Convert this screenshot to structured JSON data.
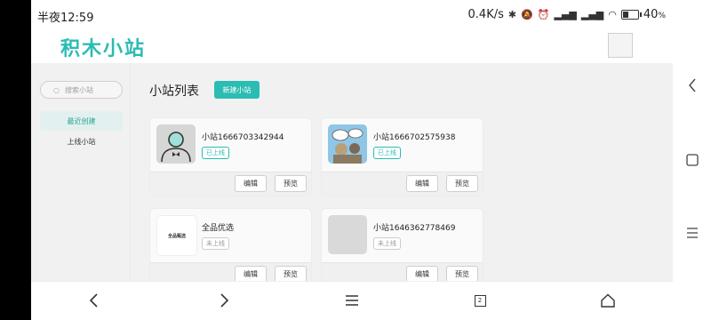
{
  "status_bar": {
    "time": "半夜12:59",
    "speed": "0.4K/s",
    "battery_pct": "40"
  },
  "site": {
    "logo": "积木小站"
  },
  "sidebar": {
    "search_placeholder": "搜索小站",
    "items": [
      {
        "label": "最近创建",
        "active": true
      },
      {
        "label": "上线小站",
        "active": false
      }
    ]
  },
  "main": {
    "title": "小站列表",
    "new_button": "新建小站",
    "cards": [
      {
        "name": "小站1666703342944",
        "status": "已上线",
        "online": true,
        "thumb_icon": "person-icon",
        "edit": "编辑",
        "preview": "预览"
      },
      {
        "name": "小站1666702575938",
        "status": "已上线",
        "online": true,
        "thumb_icon": "cartoon-chat-icon",
        "edit": "编辑",
        "preview": "预览"
      },
      {
        "name": "全品优选",
        "status": "未上线",
        "online": false,
        "thumb_icon": "brand-logo-icon",
        "thumb_text": "全品甄选",
        "edit": "编辑",
        "preview": "预览"
      },
      {
        "name": "小站1646362778469",
        "status": "未上线",
        "online": false,
        "thumb_icon": "placeholder-icon",
        "edit": "编辑",
        "preview": "预览"
      }
    ]
  },
  "navbar": {
    "tabs_count": "2"
  },
  "colors": {
    "accent": "#2bbcb4",
    "active_bg": "#e2f1ef"
  }
}
